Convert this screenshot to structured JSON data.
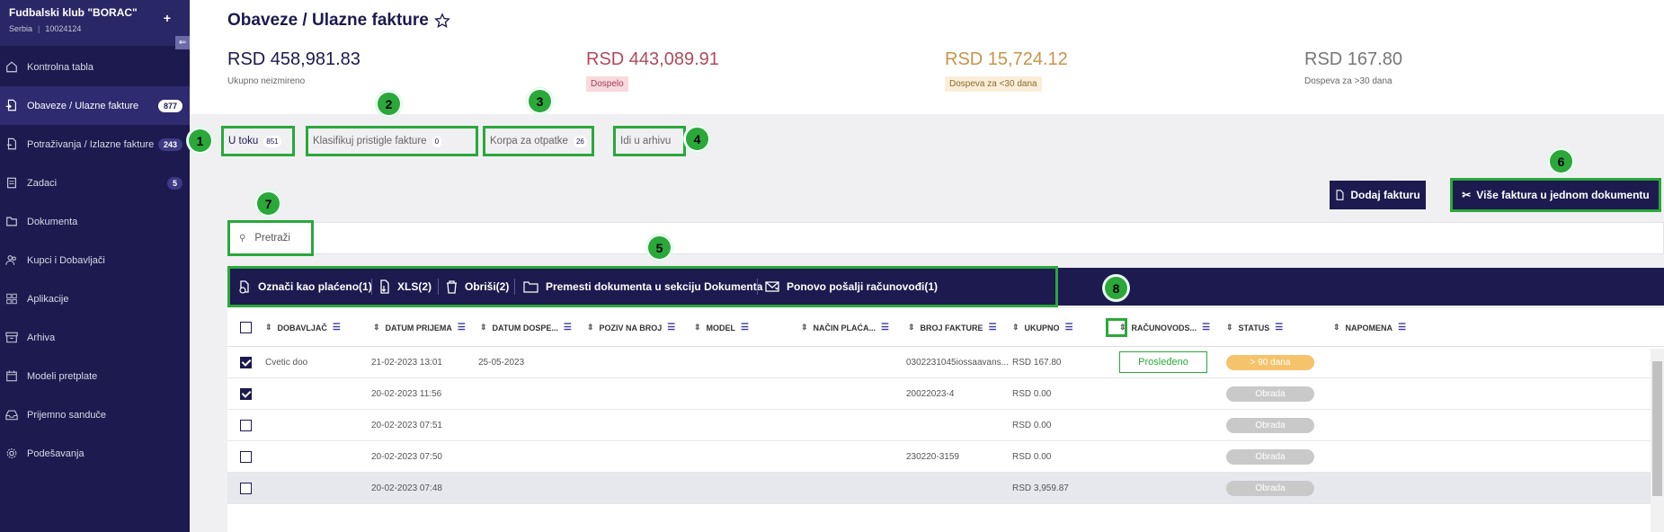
{
  "org": {
    "name": "Fudbalski klub \"BORAC\"",
    "country": "Serbia",
    "id": "10024124"
  },
  "nav": [
    {
      "label": "Kontrolna tabla",
      "icon": "home-icon",
      "badge": ""
    },
    {
      "label": "Obaveze / Ulazne fakture",
      "icon": "invoice-in-icon",
      "badge": "877",
      "active": true
    },
    {
      "label": "Potraživanja / Izlazne fakture",
      "icon": "invoice-out-icon",
      "badge": "243"
    },
    {
      "label": "Zadaci",
      "icon": "clipboard-icon",
      "badge": "5"
    },
    {
      "label": "Dokumenta",
      "icon": "documents-icon",
      "badge": ""
    },
    {
      "label": "Kupci i Dobavljači",
      "icon": "people-icon",
      "badge": ""
    },
    {
      "label": "Aplikacije",
      "icon": "apps-icon",
      "badge": ""
    },
    {
      "label": "Arhiva",
      "icon": "archive-icon",
      "badge": ""
    },
    {
      "label": "Modeli pretplate",
      "icon": "subscription-icon",
      "badge": ""
    },
    {
      "label": "Prijemno sanduče",
      "icon": "inbox-icon",
      "badge": ""
    },
    {
      "label": "Podešavanja",
      "icon": "gear-icon",
      "badge": ""
    }
  ],
  "page": {
    "title": "Obaveze / Ulazne fakture"
  },
  "stats": [
    {
      "amount": "RSD 458,981.83",
      "label": "Ukupno neizmireno",
      "color": "#1c1a4f"
    },
    {
      "amount": "RSD 443,089.91",
      "label": "Dospelo",
      "color": "#b04a5a",
      "pill_bg": "#f8d9dd"
    },
    {
      "amount": "RSD 15,724.12",
      "label": "Dospeva za <30 dana",
      "color": "#c8944a",
      "pill_bg": "#fbeed8"
    },
    {
      "amount": "RSD 167.80",
      "label": "Dospeva za >30 dana",
      "color": "#777"
    }
  ],
  "tabs": [
    {
      "label": "U toku",
      "count": "851"
    },
    {
      "label": "Klasifikuj pristigle fakture",
      "count": "0"
    },
    {
      "label": "Korpa za otpatke",
      "count": "26"
    },
    {
      "label": "Idi u arhivu",
      "count": ""
    }
  ],
  "markers": [
    "1",
    "2",
    "3",
    "4",
    "5",
    "6",
    "7",
    "8"
  ],
  "buttons": {
    "add_invoice": "Dodaj fakturu",
    "multi_invoice": "Više faktura u jednom dokumentu"
  },
  "search": {
    "placeholder": "Pretraži"
  },
  "toolbar": {
    "mark_paid": "Označi kao plaćeno(1)",
    "xls": "XLS(2)",
    "delete": "Obriši(2)",
    "move": "Premesti dokumenta u sekciju Dokumenta",
    "resend": "Ponovo pošalji računovođi(1)"
  },
  "columns": [
    "DOBAVLJAČ",
    "DATUM PRIJEMA",
    "DATUM DOSPE...",
    "POZIV NA BROJ",
    "MODEL",
    "NAČIN PLAĆA...",
    "BROJ FAKTURE",
    "UKUPNO",
    "RAČUNOVODS...",
    "STATUS",
    "NAPOMENA"
  ],
  "rows": [
    {
      "checked": true,
      "supplier": "Cvetic doo",
      "received": "21-02-2023 13:01",
      "due": "25-05-2023",
      "invoice_no": "0302231045iossaavans...",
      "total": "RSD 167.80",
      "accounting": "Prosleđeno",
      "status": "> 90 dana",
      "status_color": "#f5c36b"
    },
    {
      "checked": true,
      "supplier": "",
      "received": "20-02-2023 11:56",
      "due": "",
      "invoice_no": "20022023-4",
      "total": "RSD 0.00",
      "accounting": "",
      "status": "Obrada",
      "status_color": "#c9c9c9"
    },
    {
      "checked": false,
      "supplier": "",
      "received": "20-02-2023 07:51",
      "due": "",
      "invoice_no": "",
      "total": "RSD 0.00",
      "accounting": "",
      "status": "Obrada",
      "status_color": "#c9c9c9"
    },
    {
      "checked": false,
      "supplier": "",
      "received": "20-02-2023 07:50",
      "due": "",
      "invoice_no": "230220-3159",
      "total": "RSD 0.00",
      "accounting": "",
      "status": "Obrada",
      "status_color": "#c9c9c9"
    },
    {
      "checked": false,
      "supplier": "",
      "received": "20-02-2023 07:48",
      "due": "",
      "invoice_no": "",
      "total": "RSD 3,959.87",
      "accounting": "",
      "status": "Obrada",
      "status_color": "#c9c9c9"
    }
  ]
}
